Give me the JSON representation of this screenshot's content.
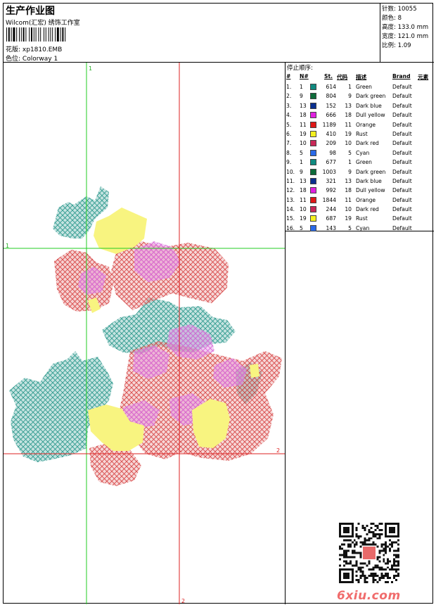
{
  "header": {
    "title": "生产作业图",
    "company": "Wilcom(汇宏) 绣饰工作室",
    "pattern_label": "花版:",
    "pattern_value": "xp1810.EMB",
    "colorway_label": "色位:",
    "colorway_value": "Colorway 1",
    "stats": [
      {
        "label": "针数:",
        "value": "10055"
      },
      {
        "label": "颜色:",
        "value": "8"
      },
      {
        "label": "高度:",
        "value": "133.0 mm"
      },
      {
        "label": "宽度:",
        "value": "121.0 mm"
      },
      {
        "label": "比例:",
        "value": "1.09"
      }
    ]
  },
  "guides": {
    "green_v_label": "1",
    "green_h_label": "1",
    "red_v_label": "2",
    "red_h_label": "2"
  },
  "stop_sequence": {
    "title": "停止顺序:",
    "columns": [
      "#",
      "N#",
      "St.",
      "代码",
      "描述",
      "Brand",
      "元素"
    ],
    "rows": [
      {
        "idx": "1.",
        "n": "1",
        "color": "#0f8a80",
        "st": "614",
        "code": "1",
        "desc": "Green",
        "brand": "Default"
      },
      {
        "idx": "2.",
        "n": "9",
        "color": "#0e6b3a",
        "st": "804",
        "code": "9",
        "desc": "Dark green",
        "brand": "Default"
      },
      {
        "idx": "3.",
        "n": "13",
        "color": "#0a2f8f",
        "st": "152",
        "code": "13",
        "desc": "Dark blue",
        "brand": "Default"
      },
      {
        "idx": "4.",
        "n": "18",
        "color": "#e020e0",
        "st": "666",
        "code": "18",
        "desc": "Dull yellow",
        "brand": "Default"
      },
      {
        "idx": "5.",
        "n": "11",
        "color": "#e01818",
        "st": "1189",
        "code": "11",
        "desc": "Orange",
        "brand": "Default"
      },
      {
        "idx": "6.",
        "n": "19",
        "color": "#f4f020",
        "st": "410",
        "code": "19",
        "desc": "Rust",
        "brand": "Default"
      },
      {
        "idx": "7.",
        "n": "10",
        "color": "#c82858",
        "st": "209",
        "code": "10",
        "desc": "Dark red",
        "brand": "Default"
      },
      {
        "idx": "8.",
        "n": "5",
        "color": "#2a6ae8",
        "st": "98",
        "code": "5",
        "desc": "Cyan",
        "brand": "Default"
      },
      {
        "idx": "9.",
        "n": "1",
        "color": "#0f8a80",
        "st": "677",
        "code": "1",
        "desc": "Green",
        "brand": "Default"
      },
      {
        "idx": "10.",
        "n": "9",
        "color": "#0e6b3a",
        "st": "1003",
        "code": "9",
        "desc": "Dark green",
        "brand": "Default"
      },
      {
        "idx": "11.",
        "n": "13",
        "color": "#0a2f8f",
        "st": "321",
        "code": "13",
        "desc": "Dark blue",
        "brand": "Default"
      },
      {
        "idx": "12.",
        "n": "18",
        "color": "#e020e0",
        "st": "992",
        "code": "18",
        "desc": "Dull yellow",
        "brand": "Default"
      },
      {
        "idx": "13.",
        "n": "11",
        "color": "#e01818",
        "st": "1844",
        "code": "11",
        "desc": "Orange",
        "brand": "Default"
      },
      {
        "idx": "14.",
        "n": "10",
        "color": "#c82858",
        "st": "244",
        "code": "10",
        "desc": "Dark red",
        "brand": "Default"
      },
      {
        "idx": "15.",
        "n": "19",
        "color": "#f4f020",
        "st": "687",
        "code": "19",
        "desc": "Rust",
        "brand": "Default"
      },
      {
        "idx": "16.",
        "n": "5",
        "color": "#2a6ae8",
        "st": "143",
        "code": "5",
        "desc": "Cyan",
        "brand": "Default"
      }
    ]
  },
  "footer": {
    "watermark": "6xiu.com"
  },
  "colors": {
    "guide_green": "#22cc22",
    "guide_red": "#dd2222",
    "teal": "#2f9a8e",
    "red": "#d84848",
    "magenta": "#d868d8",
    "yellow": "#f8f480",
    "watermark": "#f06c6c"
  }
}
